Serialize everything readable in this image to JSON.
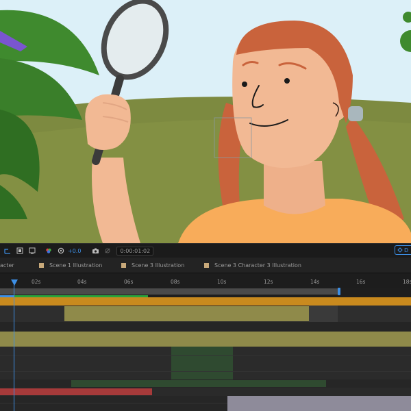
{
  "toolbar": {
    "exposure": "+0.0",
    "timecode": "0:00:01:02",
    "icons": [
      "composition-flowchart-icon",
      "region-of-interest-icon",
      "transparency-grid-icon",
      "mask-icon",
      "color-channel-icon",
      "exposure-reset-icon",
      "snapshot-camera-icon",
      "show-snapshot-icon"
    ],
    "right_button_label": "D"
  },
  "tabs": [
    {
      "label": "acter"
    },
    {
      "label": "Scene 1 Illustration"
    },
    {
      "label": "Scene 3 Illustration"
    },
    {
      "label": "Scene 3 Character 3 Illustration"
    }
  ],
  "ruler": {
    "ticks": [
      "02s",
      "04s",
      "06s",
      "08s",
      "10s",
      "12s",
      "14s",
      "16s",
      "18s"
    ]
  },
  "colors": {
    "accent": "#3d8fe6",
    "work_area": "#c98a1e",
    "layer_khaki": "#8f8a4a",
    "layer_green": "#2f4a30",
    "layer_red": "#a63a3a",
    "layer_lavender": "#8e8b9a"
  }
}
